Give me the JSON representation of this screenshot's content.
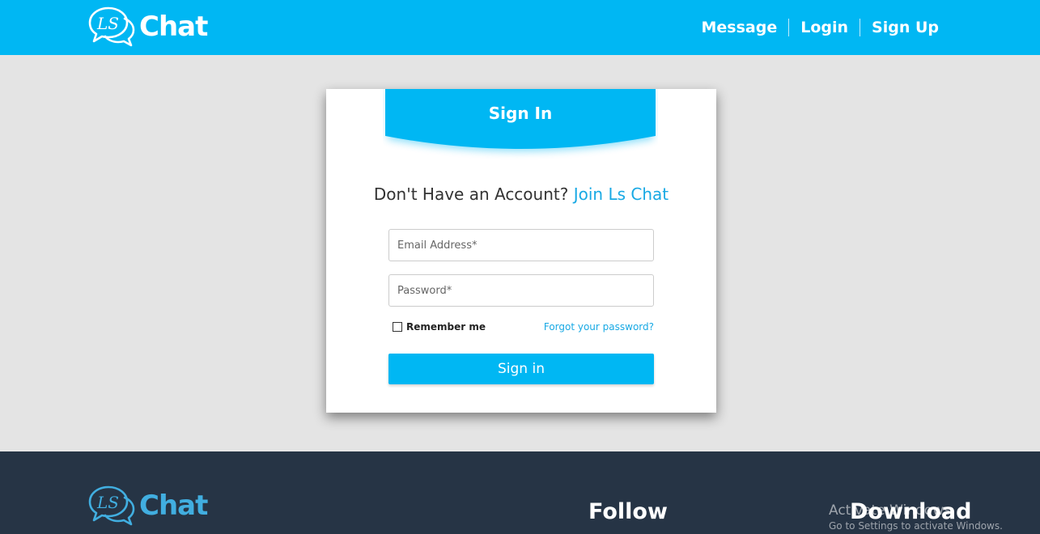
{
  "colors": {
    "brand_blue": "#00b7f3",
    "link_blue": "#18a9e4",
    "page_background": "#e4e4e4",
    "footer_background": "#263445",
    "footer_logo_text": "#41aee0"
  },
  "header": {
    "logo_icon": "speech-bubbles-ls-logo-icon",
    "logo_text": "Chat",
    "nav": {
      "message": "Message",
      "login": "Login",
      "signup": "Sign Up"
    }
  },
  "signin_card": {
    "title": "Sign In",
    "join_prompt": "Don't Have an Account?",
    "join_link": "Join Ls Chat",
    "email_placeholder": "Email Address*",
    "email_value": "",
    "password_placeholder": "Password*",
    "password_value": "",
    "remember_label": "Remember me",
    "remember_checked": false,
    "forgot_link": "Forgot your password?",
    "submit_label": "Sign in"
  },
  "footer": {
    "logo_text": "Chat",
    "follow_heading": "Follow",
    "download_heading": "Download"
  },
  "watermark": {
    "title": "Activate Windows",
    "subtitle": "Go to Settings to activate Windows."
  }
}
